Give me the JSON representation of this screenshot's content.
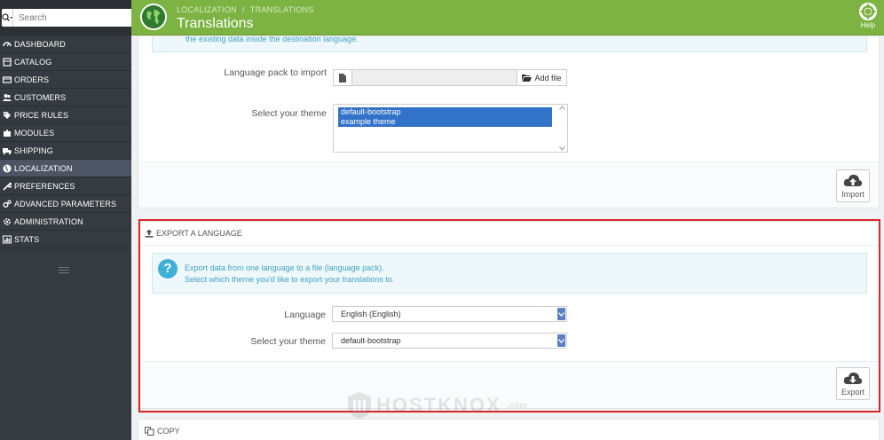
{
  "sidebar": {
    "search_placeholder": "Search",
    "items": [
      {
        "label": "Dashboard",
        "icon": "dashboard-icon"
      },
      {
        "label": "Catalog",
        "icon": "catalog-icon"
      },
      {
        "label": "Orders",
        "icon": "orders-icon"
      },
      {
        "label": "Customers",
        "icon": "customers-icon"
      },
      {
        "label": "Price Rules",
        "icon": "tag-icon"
      },
      {
        "label": "Modules",
        "icon": "puzzle-icon"
      },
      {
        "label": "Shipping",
        "icon": "truck-icon"
      },
      {
        "label": "Localization",
        "icon": "globe-icon"
      },
      {
        "label": "Preferences",
        "icon": "wrench-icon"
      },
      {
        "label": "Advanced Parameters",
        "icon": "cogs-icon"
      },
      {
        "label": "Administration",
        "icon": "gear-icon"
      },
      {
        "label": "Stats",
        "icon": "bar-chart-icon"
      }
    ],
    "active_index": 7
  },
  "header": {
    "breadcrumb": [
      "LOCALIZATION",
      "TRANSLATIONS"
    ],
    "title": "Translations",
    "help_label": "Help",
    "accent_color": "#7cb342"
  },
  "import_panel": {
    "alert_text": "the existing data inside the destination language.",
    "language_pack_label": "Language pack to import",
    "add_file_label": "Add file",
    "theme_label": "Select your theme",
    "theme_options": [
      "default-bootstrap",
      "example theme"
    ],
    "import_button": "Import"
  },
  "export_panel": {
    "heading": "EXPORT A LANGUAGE",
    "info_line1": "Export data from one language to a file (language pack).",
    "info_line2": "Select which theme you'd like to export your translations to.",
    "language_label": "Language",
    "language_value": "English (English)",
    "theme_label": "Select your theme",
    "theme_value": "default-bootstrap",
    "export_button": "Export",
    "highlight_color": "#d9262c"
  },
  "copy_panel": {
    "heading": "COPY"
  },
  "watermark": {
    "text": "HOSTKNOX",
    "domain": ".com"
  }
}
